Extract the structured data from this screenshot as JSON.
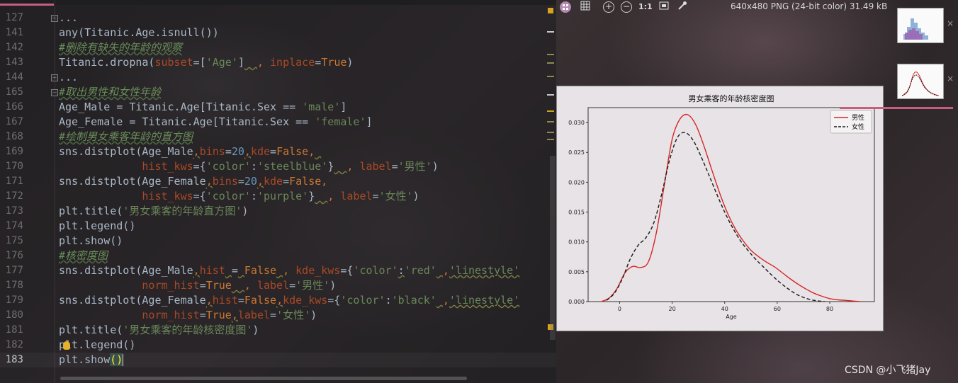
{
  "editor": {
    "lines": [
      {
        "num": "127",
        "fold": "+",
        "tokens": [
          {
            "t": "...",
            "c": ""
          }
        ]
      },
      {
        "num": "141",
        "tokens": [
          {
            "t": "any(Titanic.Age.isnull())",
            "c": ""
          }
        ]
      },
      {
        "num": "142",
        "tokens": [
          {
            "t": "#删除有缺失的年龄的观察",
            "c": "c-cm"
          }
        ]
      },
      {
        "num": "143",
        "tokens": [
          {
            "t": "Titanic.dropna(",
            "c": ""
          },
          {
            "t": "subset",
            "c": "c-kwarg"
          },
          {
            "t": "=[",
            "c": ""
          },
          {
            "t": "'Age'",
            "c": "c-str"
          },
          {
            "t": "]",
            "c": ""
          },
          {
            "t": "  ",
            "c": "squig"
          },
          {
            "t": ", ",
            "c": "c-kw"
          },
          {
            "t": "inplace",
            "c": "c-kwarg"
          },
          {
            "t": "=",
            "c": ""
          },
          {
            "t": "True",
            "c": "c-true"
          },
          {
            "t": ")",
            "c": ""
          }
        ]
      },
      {
        "num": "144",
        "fold": "+",
        "tokens": [
          {
            "t": "...",
            "c": ""
          }
        ]
      },
      {
        "num": "165",
        "fold": "-",
        "tokens": [
          {
            "t": "#取出男性和女性年龄",
            "c": "c-cm"
          }
        ]
      },
      {
        "num": "166",
        "tokens": [
          {
            "t": "Age_Male = Titanic.Age[Titanic.Sex == ",
            "c": ""
          },
          {
            "t": "'male'",
            "c": "c-str"
          },
          {
            "t": "]",
            "c": ""
          }
        ]
      },
      {
        "num": "167",
        "tokens": [
          {
            "t": "Age_Female = Titanic.Age[Titanic.Sex == ",
            "c": ""
          },
          {
            "t": "'female'",
            "c": "c-str"
          },
          {
            "t": "]",
            "c": ""
          }
        ]
      },
      {
        "num": "168",
        "tokens": [
          {
            "t": "#绘制男女乘客年龄的直方图",
            "c": "c-cm"
          }
        ]
      },
      {
        "num": "169",
        "tokens": [
          {
            "t": "sns.distplot(Age_Male",
            "c": ""
          },
          {
            "t": ",",
            "c": "c-kw squig"
          },
          {
            "t": "bins",
            "c": "c-kwarg"
          },
          {
            "t": "=",
            "c": ""
          },
          {
            "t": "20",
            "c": "c-num"
          },
          {
            "t": ",",
            "c": "c-kw squig"
          },
          {
            "t": "kde",
            "c": "c-kwarg"
          },
          {
            "t": "=",
            "c": ""
          },
          {
            "t": "False",
            "c": "c-true"
          },
          {
            "t": ",",
            "c": "c-kw"
          },
          {
            "t": " ",
            "c": "squig"
          }
        ]
      },
      {
        "num": "170",
        "tokens": [
          {
            "t": "             ",
            "c": ""
          },
          {
            "t": "hist_kws",
            "c": "c-kwarg"
          },
          {
            "t": "={",
            "c": ""
          },
          {
            "t": "'color'",
            "c": "c-str"
          },
          {
            "t": ":",
            "c": ""
          },
          {
            "t": "'steelblue'",
            "c": "c-str"
          },
          {
            "t": "}",
            "c": ""
          },
          {
            "t": "  ",
            "c": "squig"
          },
          {
            "t": ", ",
            "c": "c-kw"
          },
          {
            "t": "label",
            "c": "c-kwarg"
          },
          {
            "t": "=",
            "c": ""
          },
          {
            "t": "'男性'",
            "c": "c-str"
          },
          {
            "t": ")",
            "c": ""
          }
        ]
      },
      {
        "num": "171",
        "tokens": [
          {
            "t": "sns.distplot(Age_Female",
            "c": ""
          },
          {
            "t": ",",
            "c": "c-kw squig"
          },
          {
            "t": "bins",
            "c": "c-kwarg"
          },
          {
            "t": "=",
            "c": ""
          },
          {
            "t": "20",
            "c": "c-num"
          },
          {
            "t": ",",
            "c": "c-kw squig"
          },
          {
            "t": "kde",
            "c": "c-kwarg"
          },
          {
            "t": "=",
            "c": ""
          },
          {
            "t": "False",
            "c": "c-true"
          },
          {
            "t": ",",
            "c": "c-kw"
          }
        ]
      },
      {
        "num": "172",
        "tokens": [
          {
            "t": "             ",
            "c": ""
          },
          {
            "t": "hist_kws",
            "c": "c-kwarg"
          },
          {
            "t": "={",
            "c": ""
          },
          {
            "t": "'color'",
            "c": "c-str"
          },
          {
            "t": ":",
            "c": ""
          },
          {
            "t": "'purple'",
            "c": "c-str"
          },
          {
            "t": "}",
            "c": ""
          },
          {
            "t": "  ",
            "c": "squig"
          },
          {
            "t": ", ",
            "c": "c-kw"
          },
          {
            "t": "label",
            "c": "c-kwarg"
          },
          {
            "t": "=",
            "c": ""
          },
          {
            "t": "'女性'",
            "c": "c-str"
          },
          {
            "t": ")",
            "c": ""
          }
        ]
      },
      {
        "num": "173",
        "tokens": [
          {
            "t": "plt.title(",
            "c": ""
          },
          {
            "t": "'男女乘客的年龄直方图'",
            "c": "c-str"
          },
          {
            "t": ")",
            "c": ""
          }
        ]
      },
      {
        "num": "174",
        "tokens": [
          {
            "t": "plt.legend()",
            "c": ""
          }
        ]
      },
      {
        "num": "175",
        "tokens": [
          {
            "t": "plt.show()",
            "c": ""
          }
        ]
      },
      {
        "num": "176",
        "tokens": [
          {
            "t": "#核密度图",
            "c": "c-cm"
          }
        ]
      },
      {
        "num": "177",
        "tokens": [
          {
            "t": "sns.distplot(Age_Male",
            "c": ""
          },
          {
            "t": ",",
            "c": "c-kw squig"
          },
          {
            "t": "hist",
            "c": "c-kwarg"
          },
          {
            "t": " ",
            "c": "squig"
          },
          {
            "t": "=",
            "c": ""
          },
          {
            "t": " ",
            "c": "squig"
          },
          {
            "t": "False",
            "c": "c-true"
          },
          {
            "t": " ",
            "c": "squig"
          },
          {
            "t": ", ",
            "c": "c-kw"
          },
          {
            "t": "kde_kws",
            "c": "c-kwarg"
          },
          {
            "t": "={",
            "c": ""
          },
          {
            "t": "'color'",
            "c": "c-str"
          },
          {
            "t": ":",
            "c": "squig"
          },
          {
            "t": "'red'",
            "c": "c-str"
          },
          {
            "t": " ",
            "c": "squig"
          },
          {
            "t": ",",
            "c": "c-kw"
          },
          {
            "t": "'linestyle'",
            "c": "c-str squig"
          }
        ]
      },
      {
        "num": "178",
        "tokens": [
          {
            "t": "             ",
            "c": ""
          },
          {
            "t": "norm_hist",
            "c": "c-kwarg"
          },
          {
            "t": "=",
            "c": ""
          },
          {
            "t": "True",
            "c": "c-true"
          },
          {
            "t": "  ",
            "c": "squig"
          },
          {
            "t": ", ",
            "c": "c-kw"
          },
          {
            "t": "label",
            "c": "c-kwarg"
          },
          {
            "t": "=",
            "c": ""
          },
          {
            "t": "'男性'",
            "c": "c-str"
          },
          {
            "t": ")",
            "c": ""
          }
        ]
      },
      {
        "num": "179",
        "tokens": [
          {
            "t": "sns.distplot(Age_Female",
            "c": ""
          },
          {
            "t": ",",
            "c": "c-kw squig"
          },
          {
            "t": "hist",
            "c": "c-kwarg"
          },
          {
            "t": "=",
            "c": ""
          },
          {
            "t": "False",
            "c": "c-true"
          },
          {
            "t": ",",
            "c": "c-kw squig"
          },
          {
            "t": "kde_kws",
            "c": "c-kwarg"
          },
          {
            "t": "={",
            "c": ""
          },
          {
            "t": "'color'",
            "c": "c-str"
          },
          {
            "t": ":",
            "c": ""
          },
          {
            "t": "'black'",
            "c": "c-str"
          },
          {
            "t": " ",
            "c": "squig"
          },
          {
            "t": ",",
            "c": "c-kw"
          },
          {
            "t": "'linestyle'",
            "c": "c-str squig"
          }
        ]
      },
      {
        "num": "180",
        "tokens": [
          {
            "t": "             ",
            "c": ""
          },
          {
            "t": "norm_hist",
            "c": "c-kwarg"
          },
          {
            "t": "=",
            "c": ""
          },
          {
            "t": "True",
            "c": "c-true"
          },
          {
            "t": ",",
            "c": "c-kw squig"
          },
          {
            "t": "label",
            "c": "c-kwarg"
          },
          {
            "t": "=",
            "c": ""
          },
          {
            "t": "'女性'",
            "c": "c-str"
          },
          {
            "t": ")",
            "c": ""
          }
        ]
      },
      {
        "num": "181",
        "tokens": [
          {
            "t": "plt.title(",
            "c": ""
          },
          {
            "t": "'男女乘客的年龄核密度图'",
            "c": "c-str"
          },
          {
            "t": ")",
            "c": ""
          }
        ]
      },
      {
        "num": "182",
        "bulb": true,
        "tokens": [
          {
            "t": "p",
            "c": ""
          },
          {
            "t": "BULB",
            "c": "bulb"
          },
          {
            "t": "lt.legend()",
            "c": ""
          }
        ]
      },
      {
        "num": "183",
        "current": true,
        "tokens": [
          {
            "t": "plt.show",
            "c": ""
          },
          {
            "t": "()",
            "c": "cursor-paren"
          },
          {
            "t": "CARET",
            "c": "caret"
          }
        ]
      }
    ]
  },
  "viewer": {
    "toolbar": {
      "fit_icon": "fit-page-icon",
      "grid_icon": "grid-icon",
      "zoom_in": "+",
      "zoom_out": "−",
      "actual_size": "1:1",
      "fit_window_icon": "fit-window-icon",
      "color_picker_icon": "eyedropper-icon"
    },
    "image_info": "640x480 PNG (24-bit color) 31.49 kB",
    "thumbnails": [
      {
        "name": "histogram-thumbnail",
        "close": "×"
      },
      {
        "name": "kde-thumbnail",
        "close": "×"
      }
    ]
  },
  "watermark": "CSDN @小飞猪Jay",
  "colors": {
    "male": "#d62728",
    "female": "#1a1a1a",
    "accent": "#c65e80"
  },
  "chart_data": {
    "type": "line",
    "title": "男女乘客的年龄核密度图",
    "xlabel": "Age",
    "ylabel": "",
    "xlim": [
      -12,
      97
    ],
    "ylim": [
      0,
      0.0325
    ],
    "xticks": [
      0,
      20,
      40,
      60,
      80
    ],
    "yticks": [
      0.0,
      0.005,
      0.01,
      0.015,
      0.02,
      0.025,
      0.03
    ],
    "ytick_labels": [
      "0.000",
      "0.005",
      "0.010",
      "0.015",
      "0.020",
      "0.025",
      "0.030"
    ],
    "legend": "top-right",
    "series": [
      {
        "name": "男性",
        "color": "#d62728",
        "linestyle": "solid",
        "x": [
          -7,
          -4,
          -1,
          2,
          5,
          8,
          11,
          14,
          17,
          20,
          23,
          26,
          29,
          32,
          35,
          38,
          41,
          44,
          47,
          50,
          53,
          56,
          59,
          62,
          65,
          68,
          71,
          74,
          77,
          80,
          83,
          86,
          89,
          92
        ],
        "y": [
          0.0,
          0.0006,
          0.0022,
          0.0048,
          0.0059,
          0.0057,
          0.0067,
          0.0116,
          0.0195,
          0.0272,
          0.0306,
          0.0313,
          0.0296,
          0.0262,
          0.0222,
          0.0183,
          0.0149,
          0.0122,
          0.0102,
          0.0086,
          0.0075,
          0.0066,
          0.0058,
          0.0048,
          0.0038,
          0.0029,
          0.0021,
          0.0014,
          0.0009,
          0.0005,
          0.0003,
          0.0002,
          0.0001,
          0.0
        ]
      },
      {
        "name": "女性",
        "color": "#1a1a1a",
        "linestyle": "dashed",
        "x": [
          -5,
          -2,
          1,
          4,
          7,
          10,
          13,
          16,
          19,
          22,
          25,
          28,
          31,
          34,
          37,
          40,
          43,
          46,
          49,
          52,
          55,
          58,
          61,
          64,
          67,
          70,
          73,
          76,
          78
        ],
        "y": [
          0.0002,
          0.0014,
          0.0038,
          0.0071,
          0.0094,
          0.0107,
          0.0132,
          0.018,
          0.0237,
          0.0275,
          0.0283,
          0.027,
          0.0243,
          0.0212,
          0.018,
          0.015,
          0.0124,
          0.0102,
          0.0085,
          0.007,
          0.0057,
          0.0044,
          0.0032,
          0.0022,
          0.0013,
          0.0007,
          0.0003,
          0.0001,
          0.0
        ]
      }
    ]
  }
}
